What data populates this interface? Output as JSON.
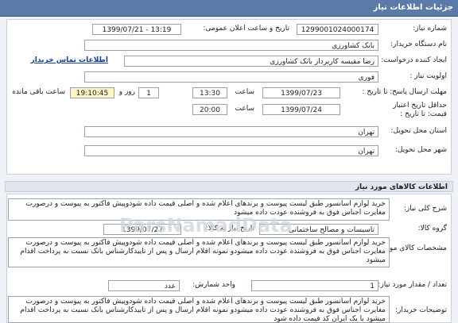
{
  "header": {
    "title": "جزئیات اطلاعات نیاز"
  },
  "fields": {
    "need_number_label": "شماره نیاز:",
    "need_number": "1299001024000174",
    "announce_datetime_label": "تاریخ و ساعت اعلان عمومی:",
    "announce_datetime": "1399/07/21 - 13:19",
    "buyer_org_label": "نام دستگاه خریدار:",
    "buyer_org": "بانک کشاورزی",
    "creator_label": "ایجاد کننده درخواست:",
    "creator": "رضا مقیسه کاربرداز بانک کشاورزی",
    "buyer_contact_link": "اطلاعات تماس خریدار",
    "priority_label": "اولویت نیاز :",
    "priority": "فوری",
    "reply_deadline_label": "مهلت ارسال پاسخ: تا تاریخ :",
    "reply_date": "1399/07/23",
    "time_label": "ساعت",
    "reply_time": "13:30",
    "days_value": "1",
    "days_label": "روز و",
    "remaining_time": "19:10:45",
    "remaining_label": "ساعت باقی مانده",
    "price_validity_label": "حداقل تاریخ اعتبار قیمت: تا تاریخ :",
    "price_validity_date": "1399/07/24",
    "time_label2": "ساعت",
    "price_validity_time": "20:00",
    "province_label": "استان محل تحویل:",
    "province": "تهران",
    "city_label": "شهر محل تحویل:",
    "city": "تهران"
  },
  "goods_section": {
    "title": "اطلاعات کالاهای مورد نیاز",
    "general_desc_label": "شرح کلی نیاز:",
    "general_desc": "خرید لوازم اسانسور طبق لیست پیوست و برندهای اعلام شده و اصلی قیمت داده شودوپیش فاکتور به پیوست و درصورت مغایرت اجناس فوق به فروشنده عودت داده میشود",
    "group_label": "گروه کالا:",
    "group": "تاسیسات و مصالح ساختمانی",
    "need_date_label": "تاریخ نیاز به کالا:",
    "need_date": "1399/07/27",
    "specs_label": "مشخصات کالای مورد نیاز:",
    "specs": "خرید لوازم اسانسور طبق لیست پیوست و برندهای اعلام شده و اصلی قیمت داده شودوپیش فاکتور به پیوست و درصورت مغایرت اجناس فوق به فروشنده عودت داده میشودو نمونه اقلام ارسال و پس از تاییدکارشناس بانک نسبت به پرداخت اقدام میشود",
    "count_label": "تعداد / مقدار مورد نیاز:",
    "count": "1",
    "unit_label": "واحد شمارش:",
    "unit": "عدد",
    "buyer_notes_label": "توضیحات خریدار:",
    "buyer_notes": "خرید لوازم اسانسور طبق لیست پیوست و برندهای اعلام شده و اصلی قیمت داده شودوپیش فاکتور به پیوست و درصورت مغایرت اجناس فوق به فروشنده عودت داده میشودو نمونه اقلام ارسال و پس از تاییدکارشناس بانک نسبت به پرداخت اقدام میشود با یک ایران کد قیمت داده شود"
  },
  "watermark": "ParsNamadData"
}
